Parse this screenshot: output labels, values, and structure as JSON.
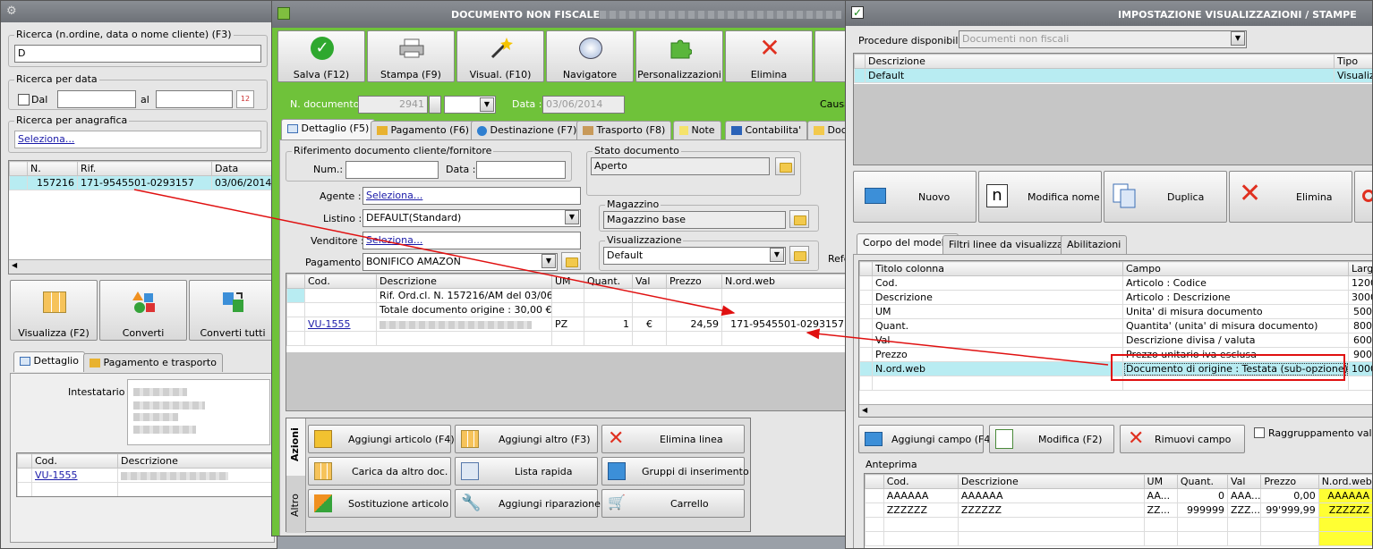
{
  "left": {
    "search_label": "Ricerca (n.ordine, data o nome cliente) (F3)",
    "search_value": "D",
    "date_label": "Ricerca per data",
    "dal": "Dal",
    "al": "al",
    "anag_label": "Ricerca per anagrafica",
    "anag_value": "Seleziona...",
    "grid_headers": [
      "N.",
      "Rif.",
      "Data"
    ],
    "grid_row": {
      "n": "157216",
      "rif": "171-9545501-0293157",
      "data": "03/06/2014"
    },
    "buttons": [
      "Visualizza (F2)",
      "Converti",
      "Converti tutti"
    ],
    "tabs": [
      "Dettaglio",
      "Pagamento e trasporto"
    ],
    "intestatario": "Intestatario :",
    "items_headers": [
      "Cod.",
      "Descrizione"
    ],
    "items_row": {
      "cod": "VU-1555"
    }
  },
  "doc": {
    "title": "DOCUMENTO NON FISCALE",
    "toolbar": [
      "Salva (F12)",
      "Stampa (F9)",
      "Visual. (F10)",
      "Navigatore",
      "Personalizzazioni",
      "Elimina"
    ],
    "ndoc_label": "N. documento :",
    "ndoc_value": "2941",
    "data_label": "Data :",
    "data_value": "03/06/2014",
    "causa": "Causa",
    "tabs": [
      "Dettaglio (F5)",
      "Pagamento (F6)",
      "Destinazione (F7)",
      "Trasporto (F8)",
      "Note",
      "Contabilita'",
      "Docu"
    ],
    "rif_group": "Riferimento documento cliente/fornitore",
    "num_label": "Num.:",
    "data2_label": "Data :",
    "stato_group": "Stato documento",
    "stato_value": "Aperto",
    "agente_label": "Agente :",
    "agente_value": "Seleziona...",
    "listino_label": "Listino :",
    "listino_value": "DEFAULT(Standard)",
    "venditore_label": "Venditore :",
    "venditore_value": "Seleziona...",
    "pagamento_label": "Pagamento :",
    "pagamento_value": "BONIFICO AMAZON",
    "magazzino_group": "Magazzino",
    "magazzino_value": "Magazzino base",
    "visual_group": "Visualizzazione",
    "visual_value": "Default",
    "refe": "Refe",
    "grid_headers": [
      "Cod.",
      "Descrizione",
      "UM",
      "Quant.",
      "Val",
      "Prezzo",
      "N.ord.web"
    ],
    "rows": [
      {
        "cod": "",
        "desc": "Rif. Ord.cl. N. 157216/AM del 03/06/...",
        "um": "",
        "q": "",
        "val": "",
        "prezzo": "",
        "web": ""
      },
      {
        "cod": "",
        "desc": "Totale documento origine : 30,00 €",
        "um": "",
        "q": "",
        "val": "",
        "prezzo": "",
        "web": ""
      },
      {
        "cod": "VU-1555",
        "desc": "",
        "um": "PZ",
        "q": "1",
        "val": "€",
        "prezzo": "24,59",
        "web": "171-9545501-0293157"
      }
    ],
    "side_tabs": [
      "Azioni",
      "Altro"
    ],
    "actions": [
      "Aggiungi articolo (F4)",
      "Aggiungi altro (F3)",
      "Elimina linea",
      "Carica da altro doc.",
      "Lista rapida",
      "Gruppi di inserimento",
      "Sostituzione articolo",
      "Aggiungi riparazione",
      "Carrello"
    ]
  },
  "imp": {
    "title": "IMPOSTAZIONE VISUALIZZAZIONI / STAMPE",
    "proc_label": "Procedure disponibili :",
    "proc_value": "Documenti non fiscali",
    "top_headers": [
      "Descrizione",
      "Tipo"
    ],
    "top_row": {
      "desc": "Default",
      "tipo": "Visualizza"
    },
    "buttons": [
      "Nuovo",
      "Modifica nome",
      "Duplica",
      "Elimina"
    ],
    "tabs": [
      "Corpo del modello",
      "Filtri linee da visualizzare",
      "Abilitazioni"
    ],
    "col_headers": [
      "Titolo colonna",
      "Campo",
      "Larg."
    ],
    "cols": [
      {
        "t": "Cod.",
        "c": "Articolo : Codice",
        "l": "1200"
      },
      {
        "t": "Descrizione",
        "c": "Articolo : Descrizione",
        "l": "3000"
      },
      {
        "t": "UM",
        "c": "Unita' di misura documento",
        "l": "500"
      },
      {
        "t": "Quant.",
        "c": "Quantita' (unita' di misura documento)",
        "l": "800"
      },
      {
        "t": "Val",
        "c": "Descrizione divisa / valuta",
        "l": "600"
      },
      {
        "t": "Prezzo",
        "c": "Prezzo unitario iva esclusa",
        "l": "900"
      },
      {
        "t": "N.ord.web",
        "c": "Documento di origine : Testata (sub-opzione)",
        "l": "1000"
      }
    ],
    "bottom_buttons": [
      "Aggiungi campo (F4)",
      "Modifica (F2)",
      "Rimuovi campo"
    ],
    "raggruppamento": "Raggruppamento valori",
    "anteprima": "Anteprima",
    "prev_headers": [
      "Cod.",
      "Descrizione",
      "UM",
      "Quant.",
      "Val",
      "Prezzo",
      "N.ord.web"
    ],
    "prev_rows": [
      {
        "cod": "AAAAAA",
        "desc": "AAAAAA",
        "um": "AA...",
        "q": "0",
        "val": "AAA...",
        "prezzo": "0,00",
        "web": "AAAAAA"
      },
      {
        "cod": "ZZZZZZ",
        "desc": "ZZZZZZ",
        "um": "ZZ...",
        "q": "999999",
        "val": "ZZZ...",
        "prezzo": "99'999,99",
        "web": "ZZZZZZ"
      }
    ]
  }
}
